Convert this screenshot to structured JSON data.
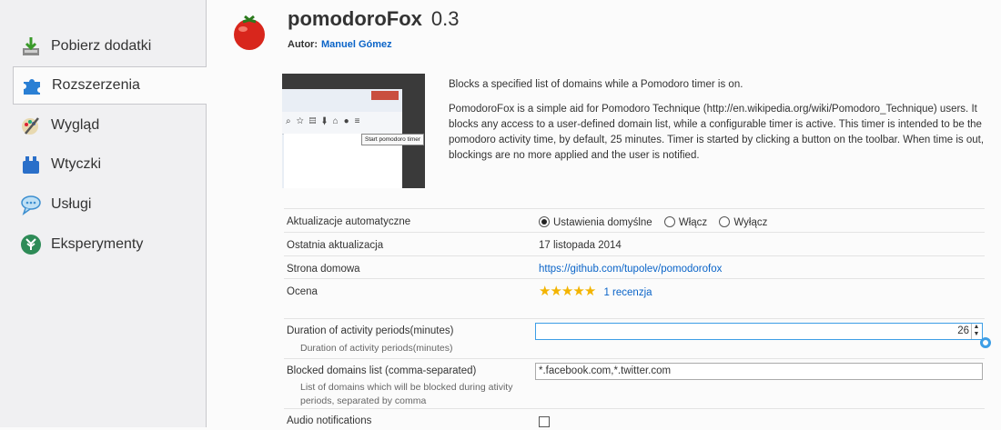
{
  "sidebar": {
    "items": [
      {
        "label": "Pobierz dodatki",
        "icon": "download-icon"
      },
      {
        "label": "Rozszerzenia",
        "icon": "puzzle-icon"
      },
      {
        "label": "Wygląd",
        "icon": "brush-icon"
      },
      {
        "label": "Wtyczki",
        "icon": "plugin-icon"
      },
      {
        "label": "Usługi",
        "icon": "chat-icon"
      },
      {
        "label": "Eksperymenty",
        "icon": "experiments-icon"
      }
    ],
    "selected": "Rozszerzenia"
  },
  "addon": {
    "name": "pomodoroFox",
    "version": "0.3",
    "author_label": "Autor:",
    "author": "Manuel Gómez",
    "icon": "tomato-icon",
    "screenshot_tooltip": "Start pomodoro timer",
    "summary": "Blocks a specified list of domains while a Pomodoro timer is on.",
    "description": "PomodoroFox is a simple aid for Pomodoro Technique (http://en.wikipedia.org/wiki/Pomodoro_Technique) users. It blocks any access to a user-defined domain list, while a configurable timer is active. This timer is intended to be the pomodoro activity time, by default, 25 minutes. Timer is started by clicking a button on the toolbar. When time is out, blockings are no more applied and the user is notified."
  },
  "details": {
    "auto_update_label": "Aktualizacje automatyczne",
    "auto_update_options": [
      "Ustawienia domyślne",
      "Włącz",
      "Wyłącz"
    ],
    "auto_update_selected": "Ustawienia domyślne",
    "last_update_label": "Ostatnia aktualizacja",
    "last_update_value": "17 listopada 2014",
    "homepage_label": "Strona domowa",
    "homepage_value": "https://github.com/tupolev/pomodorofox",
    "rating_label": "Ocena",
    "rating_stars": 5,
    "rating_reviews": "1 recenzja"
  },
  "prefs": {
    "duration_label": "Duration of activity periods(minutes)",
    "duration_sub": "Duration of activity periods(minutes)",
    "duration_value": "26",
    "blocked_label": "Blocked domains list (comma-separated)",
    "blocked_sub": "List of domains which will be blocked during ativity periods, separated by comma",
    "blocked_value": "*.facebook.com,*.twitter.com",
    "audio_label": "Audio notifications",
    "audio_checked": false
  },
  "colors": {
    "link": "#0a64c8",
    "star": "#f3b400",
    "accent": "#3d9ee6"
  }
}
